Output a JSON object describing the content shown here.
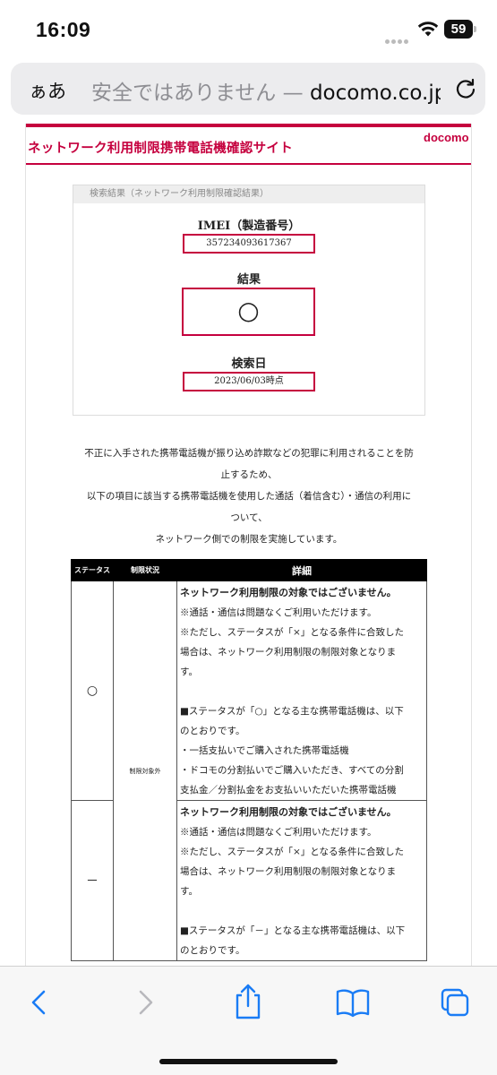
{
  "status_bar": {
    "time": "16:09",
    "battery_level": "59",
    "icons": [
      "signal-dots-icon",
      "wifi-icon",
      "battery-icon"
    ]
  },
  "browser": {
    "reader_label": "ぁあ",
    "url_insecure_label": "安全ではありません — ",
    "url_domain": "docomo.co.jp",
    "reload_icon": "reload-icon"
  },
  "site": {
    "title": "ネットワーク利用制限携帯電話機確認サイト",
    "brand": "docomo",
    "brand_color": "#c5003e"
  },
  "result": {
    "heading": "検索結果（ネットワーク利用制限確認結果）",
    "imei_label": "IMEI（製造番号）",
    "imei_value": "357234093617367",
    "result_label": "結果",
    "result_value": "○",
    "date_label": "検索日",
    "date_value": "2023/06/03時点"
  },
  "notice": [
    "不正に入手された携帯電話機が振り込め詐欺などの犯罪に利用されることを防",
    "止するため、",
    "以下の項目に該当する携帯電話機を使用した通話（着信含む）・通信の利用に",
    "ついて、",
    "ネットワーク側での制限を実施しています。"
  ],
  "table": {
    "headers": [
      "ステータス",
      "制限状況",
      "詳細"
    ],
    "restriction_label": "制限対象外",
    "rows": [
      {
        "status": "○",
        "lead": "ネットワーク利用制限の対象ではございません。",
        "lines": [
          "※通話・通信は問題なくご利用いただけます。",
          "※ただし、ステータスが「×」となる条件に合致した",
          "場合は、ネットワーク利用制限の制限対象となりま",
          "す。"
        ],
        "lines2": [
          "■ステータスが「○」となる主な携帯電話機は、以下",
          "のとおりです。",
          "・一括支払いでご購入された携帯電話機",
          "・ドコモの分割払いでご購入いただき、すべての分割",
          "支払金／分割払金をお支払いいただいた携帯電話機"
        ]
      },
      {
        "status": "－",
        "lead": "ネットワーク利用制限の対象ではございません。",
        "lines": [
          "※通話・通信は問題なくご利用いただけます。",
          "※ただし、ステータスが「×」となる条件に合致した",
          "場合は、ネットワーク利用制限の制限対象となりま",
          "す。"
        ],
        "lines2": [
          "■ステータスが「－」となる主な携帯電話機は、以下",
          "のとおりです。"
        ]
      }
    ]
  },
  "toolbar": {
    "icons": [
      "back-icon",
      "forward-icon",
      "share-icon",
      "bookmarks-icon",
      "tabs-icon"
    ]
  }
}
